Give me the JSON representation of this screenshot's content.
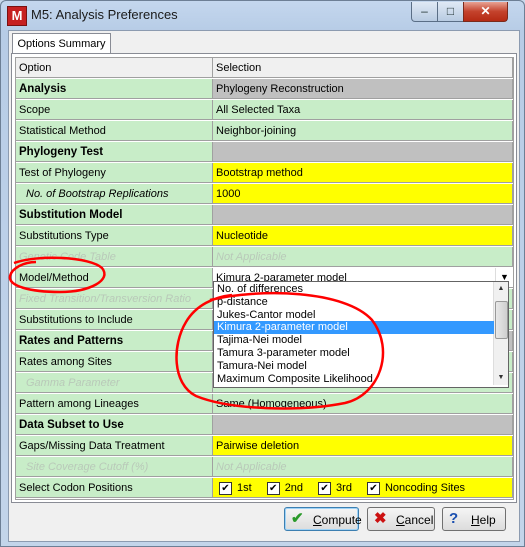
{
  "window": {
    "title": "M5: Analysis Preferences",
    "app_icon": "M"
  },
  "tab": {
    "label": "Options Summary"
  },
  "columns": {
    "option": "Option",
    "selection": "Selection"
  },
  "rows": [
    {
      "option": "Analysis",
      "selection": "Phylogeny Reconstruction",
      "style": "section"
    },
    {
      "option": "Scope",
      "selection": "All Selected Taxa",
      "style": "normal"
    },
    {
      "option": "Statistical Method",
      "selection": "Neighbor-joining",
      "style": "normal"
    },
    {
      "option": "Phylogeny Test",
      "selection": "",
      "style": "section"
    },
    {
      "option": "Test of Phylogeny",
      "selection": "Bootstrap method",
      "style": "editable"
    },
    {
      "option": "No. of Bootstrap Replications",
      "selection": "1000",
      "style": "editable-sub"
    },
    {
      "option": "Substitution Model",
      "selection": "",
      "style": "section"
    },
    {
      "option": "Substitutions Type",
      "selection": "Nucleotide",
      "style": "editable"
    },
    {
      "option": "Genetic Code Table",
      "selection": "Not Applicable",
      "style": "disabled"
    },
    {
      "option": "Model/Method",
      "selection": "Kimura 2-parameter model",
      "style": "combo"
    },
    {
      "option": "Fixed Transition/Transversion Ratio",
      "selection": "",
      "style": "disabled"
    },
    {
      "option": "Substitutions to Include",
      "selection": "",
      "style": "normal"
    },
    {
      "option": "Rates and Patterns",
      "selection": "",
      "style": "section"
    },
    {
      "option": "Rates among Sites",
      "selection": "",
      "style": "normal"
    },
    {
      "option": "Gamma Parameter",
      "selection": "",
      "style": "disabled-sub"
    },
    {
      "option": "Pattern among Lineages",
      "selection": "Same (Homogeneous)",
      "style": "normal"
    },
    {
      "option": "Data Subset to Use",
      "selection": "",
      "style": "section"
    },
    {
      "option": "Gaps/Missing Data Treatment",
      "selection": "Pairwise deletion",
      "style": "editable"
    },
    {
      "option": "Site Coverage Cutoff (%)",
      "selection": "Not Applicable",
      "style": "disabled-sub"
    },
    {
      "option": "Select Codon Positions",
      "selection": "",
      "style": "codons"
    }
  ],
  "dropdown": {
    "items": [
      "No. of differences",
      "p-distance",
      "Jukes-Cantor model",
      "Kimura 2-parameter model",
      "Tajima-Nei model",
      "Tamura 3-parameter model",
      "Tamura-Nei model",
      "Maximum Composite Likelihood"
    ],
    "selected": "Kimura 2-parameter model"
  },
  "codons": [
    {
      "label": "1st",
      "checked": true
    },
    {
      "label": "2nd",
      "checked": true
    },
    {
      "label": "3rd",
      "checked": true
    },
    {
      "label": "Noncoding Sites",
      "checked": true
    }
  ],
  "buttons": {
    "compute": {
      "pre": "",
      "u": "C",
      "post": "ompute"
    },
    "cancel": {
      "pre": "",
      "u": "C",
      "post": "ancel"
    },
    "help": {
      "pre": "",
      "u": "H",
      "post": "elp"
    }
  },
  "colors": {
    "option_bg": "#c8edc8",
    "editable_bg": "#ffff00",
    "section_bg": "#c0c0c0",
    "annotation": "#ff0000",
    "selected": "#3399ff"
  }
}
